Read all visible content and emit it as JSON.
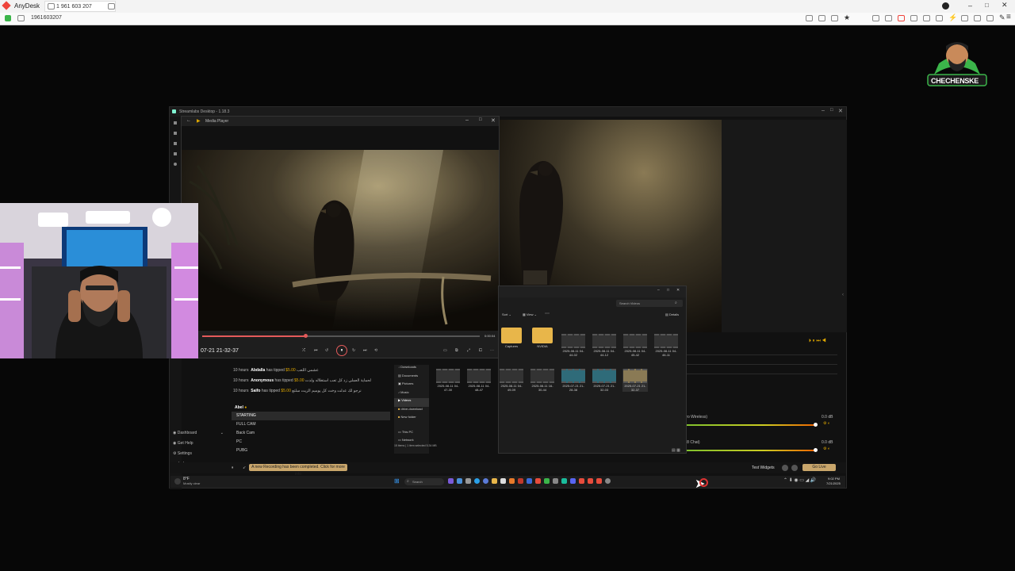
{
  "anydesk": {
    "app_name": "AnyDesk",
    "tab_label": "1 961 603 207",
    "address": "1961603207",
    "colors": {
      "brand": "#ef443b",
      "ok": "#3bb54a"
    }
  },
  "streamlabs": {
    "title": "Streamlabs Desktop - 1.18.3",
    "activity": [
      {
        "time": "10 hours",
        "name": "Abdalla",
        "action": "has tipped",
        "amount": "$5.00",
        "message": "عشمي اللعب"
      },
      {
        "time": "10 hours",
        "name": "Anonymous",
        "action": "has tipped",
        "amount": "$5.00",
        "message": "لحماية العملي زد كل تعب استغلاله ولدت"
      },
      {
        "time": "10 hours",
        "name": "Saifo",
        "action": "has tipped",
        "amount": "$5.00",
        "message": "نرجو لك عدلت وخت كل يوميم الزيت سلتع"
      }
    ],
    "scenes_header": "Abel",
    "scenes": [
      "STARTING",
      "FULL CAM",
      "Back Cam",
      "PC",
      "PUBG"
    ],
    "nav": [
      {
        "label": "Dashboard",
        "icon": "dashboard-icon"
      },
      {
        "label": "Get Help",
        "icon": "help-icon"
      },
      {
        "label": "Settings",
        "icon": "settings-icon"
      }
    ],
    "user": "abel",
    "notification": "A new Recording has been completed. Click for more info",
    "test_widgets": "Test Widgets",
    "go_live": "Go Live",
    "mixer": [
      {
        "label": "Pro Wireless)",
        "db": "0.0 dB"
      },
      {
        "label": "h 8 Chat)",
        "db": "0.0 dB"
      }
    ]
  },
  "media_player": {
    "title": "Media Player",
    "timestamp": "07-21 21-32-37",
    "duration": "0:00:04",
    "progress": 0.37
  },
  "explorer": {
    "search_placeholder": "Search Videos",
    "toolbar": {
      "sort": "Sort",
      "view": "View",
      "details": "Details"
    },
    "nav": [
      "Downloads",
      "Documents",
      "Pictures",
      "Music",
      "Videos",
      "drive-download",
      "New folder"
    ],
    "pc_items": [
      "This PC",
      "Network"
    ],
    "folders": [
      {
        "name": "Captures"
      },
      {
        "name": "NVIDIA"
      }
    ],
    "videos": [
      "2025-08-11 04-44-02",
      "2025-08-11 04-44-12",
      "2025-08-11 04-45-42",
      "2025-08-11 04-46-11",
      "2025-08-11 04-47-30",
      "2025-08-11 04-48-47",
      "2025-08-11 04-49-09",
      "2025-08-11 16-30-44",
      "2025-07-21 21-28-38",
      "2025-07-21 21-32-03",
      "2025-07-21 21-32-37"
    ],
    "status": "15 items | 1 item selected 5.34 MB"
  },
  "taskbar": {
    "weather_temp": "8°F",
    "weather_desc": "Mostly clear",
    "search": "Search",
    "time": "9:02 PM",
    "date": "7/21/2025"
  },
  "logo": {
    "text": "CHECHENSKE"
  }
}
